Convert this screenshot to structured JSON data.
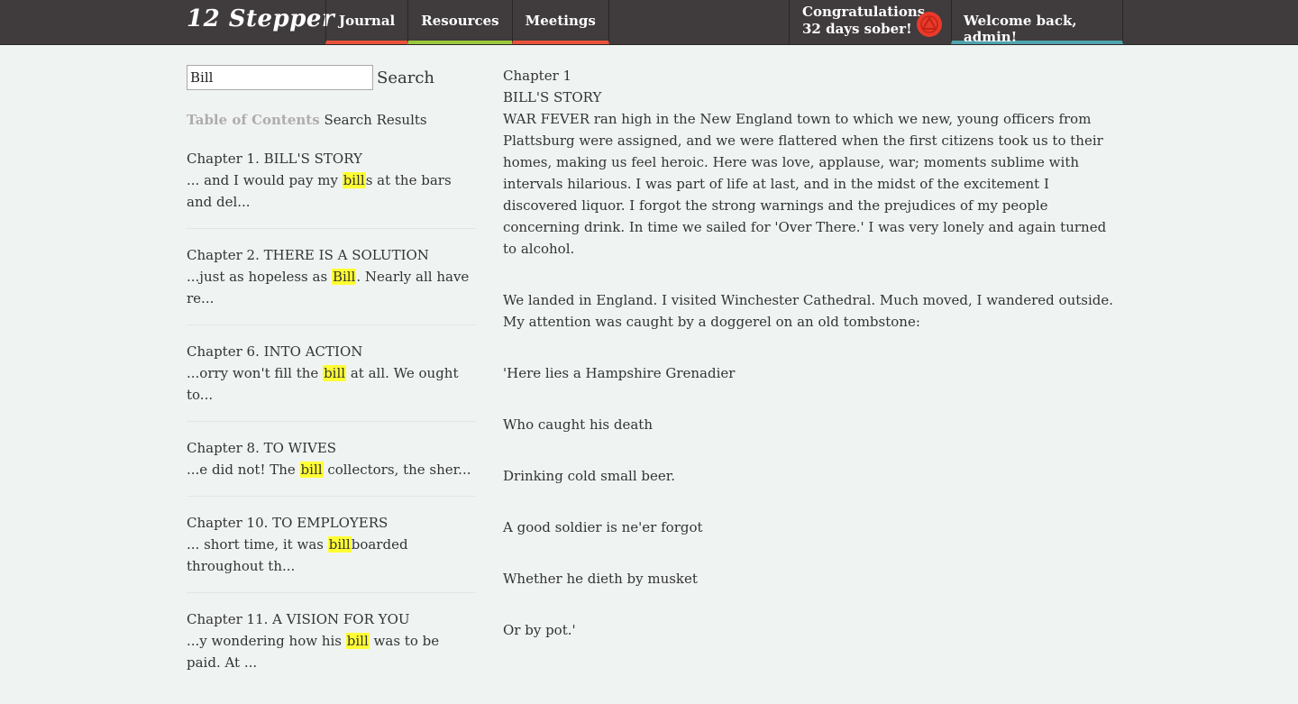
{
  "header": {
    "brand": "12 Stepper",
    "nav": [
      {
        "label": "Journal",
        "color": "#e8523a"
      },
      {
        "label": "Resources",
        "color": "#9bc83a"
      },
      {
        "label": "Meetings",
        "color": "#e8523a"
      }
    ],
    "congrats_line1": "Congratulations,",
    "congrats_line2": "32 days sober!",
    "logo_icon": "aa-triangle-icon",
    "welcome": "Welcome back, admin!"
  },
  "sidebar": {
    "search_value": "Bill",
    "search_label": "Search",
    "tab_toc": "Table of Contents",
    "tab_results": "Search Results",
    "results": [
      {
        "title": "Chapter 1. BILL'S STORY",
        "pre": "... and I would pay my ",
        "hit": "bill",
        "post": "s at the bars and del..."
      },
      {
        "title": "Chapter 2. THERE IS A SOLUTION",
        "pre": "...just as hopeless as ",
        "hit": "Bill",
        "post": ". Nearly all have re..."
      },
      {
        "title": "Chapter 6. INTO ACTION",
        "pre": "...orry won't fill the ",
        "hit": "bill",
        "post": " at all. We ought to..."
      },
      {
        "title": "Chapter 8. TO WIVES",
        "pre": "...e did not! The ",
        "hit": "bill",
        "post": " collectors, the sher..."
      },
      {
        "title": "Chapter 10. TO EMPLOYERS",
        "pre": "... short time, it was ",
        "hit": "bill",
        "post": "boarded throughout th..."
      },
      {
        "title": "Chapter 11. A VISION FOR YOU",
        "pre": "...y wondering how his ",
        "hit": "bill",
        "post": " was to be paid. At ..."
      }
    ]
  },
  "content": {
    "chapter_label": "Chapter 1",
    "chapter_title": "BILL'S STORY",
    "paragraphs": [
      "WAR FEVER ran high in the New England town to which we new, young officers from Plattsburg were assigned, and we were flattered when the first citizens took us to their homes, making us feel heroic. Here was love, applause, war; moments sublime with intervals hilarious. I was part of life at last, and in the midst of the excitement I discovered liquor. I forgot the strong warnings and the prejudices of my people concerning drink. In time we sailed for 'Over There.' I was very lonely and again turned to alcohol.",
      "We landed in England. I visited Winchester Cathedral. Much moved, I wandered outside. My attention was caught by a doggerel on an old tombstone:"
    ],
    "verses": [
      "'Here lies a Hampshire Grenadier",
      "Who caught his death",
      "Drinking cold small beer.",
      "A good soldier is ne'er forgot",
      "Whether he dieth by musket",
      "Or by pot.'"
    ]
  }
}
